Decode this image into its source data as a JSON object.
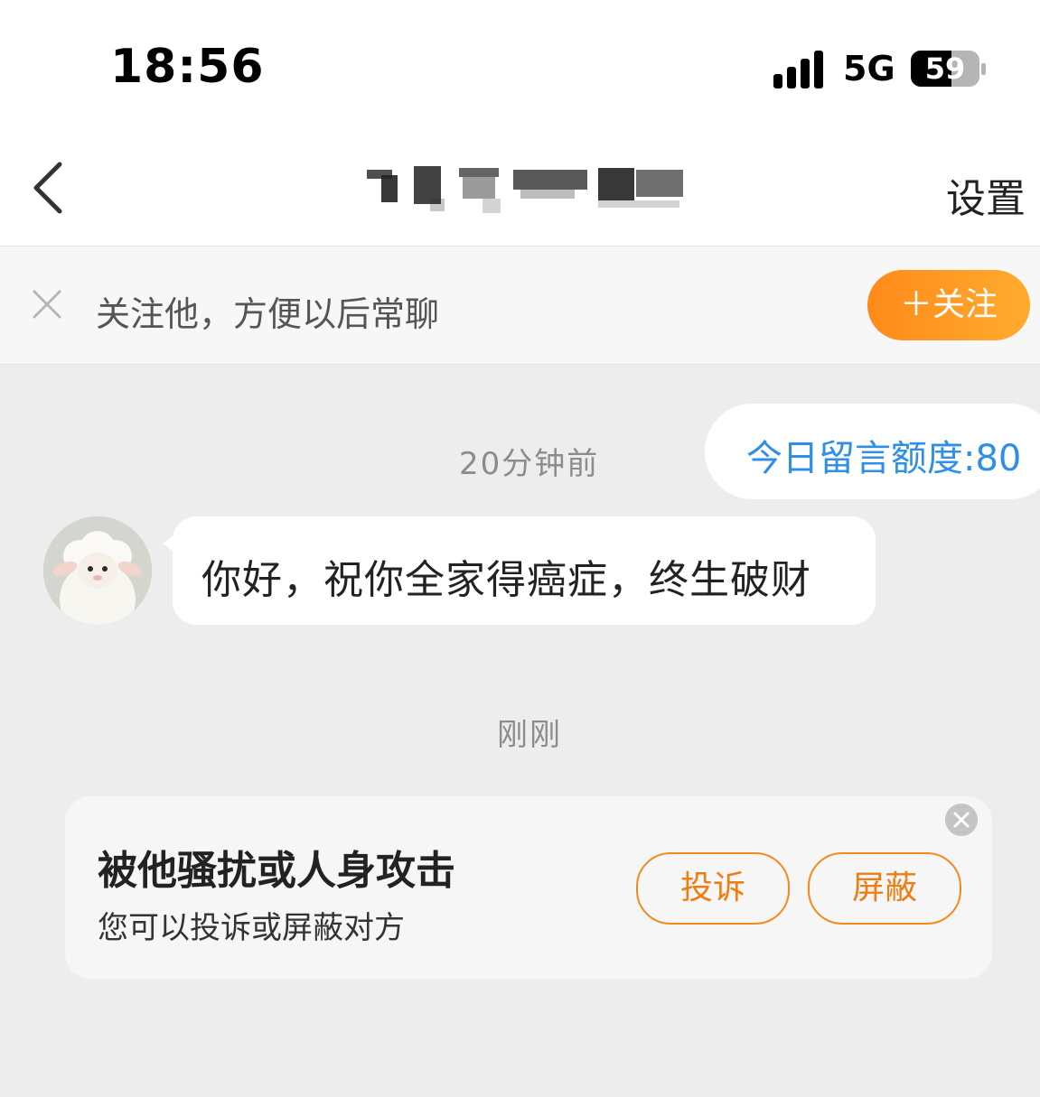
{
  "status_bar": {
    "time": "18:56",
    "network": "5G",
    "battery_level": "59",
    "battery_fraction": 0.59
  },
  "nav": {
    "title_redacted": true,
    "settings_label": "设置"
  },
  "follow_banner": {
    "text": "关注他，方便以后常聊",
    "button_label": "＋关注"
  },
  "chat": {
    "quota_text": "今日留言额度:80",
    "messages": [
      {
        "time_label": "20分钟前",
        "sender": "other",
        "text": "你好，祝你全家得癌症，终生破财"
      }
    ],
    "recent_time_label": "刚刚"
  },
  "harassment_card": {
    "title": "被他骚扰或人身攻击",
    "subtitle": "您可以投诉或屏蔽对方",
    "report_label": "投诉",
    "block_label": "屏蔽"
  },
  "colors": {
    "accent_orange": "#ff8a1a",
    "link_blue": "#2f8ee8",
    "chat_bg": "#ededed"
  }
}
